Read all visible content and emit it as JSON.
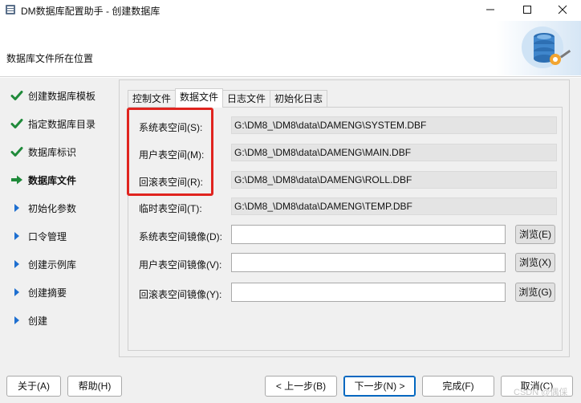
{
  "window": {
    "title": "DM数据库配置助手 - 创建数据库",
    "minimize_icon": "minimize-icon",
    "maximize_icon": "maximize-icon",
    "close_icon": "close-icon"
  },
  "banner": {
    "title": "数据库文件所在位置",
    "art_icon": "database-gear-icon"
  },
  "steps": [
    {
      "label": "创建数据库模板",
      "state": "done"
    },
    {
      "label": "指定数据库目录",
      "state": "done"
    },
    {
      "label": "数据库标识",
      "state": "done"
    },
    {
      "label": "数据库文件",
      "state": "current"
    },
    {
      "label": "初始化参数",
      "state": "pending"
    },
    {
      "label": "口令管理",
      "state": "pending"
    },
    {
      "label": "创建示例库",
      "state": "pending"
    },
    {
      "label": "创建摘要",
      "state": "pending"
    },
    {
      "label": "创建",
      "state": "pending"
    }
  ],
  "tabs": [
    {
      "label": "控制文件",
      "active": false
    },
    {
      "label": "数据文件",
      "active": true
    },
    {
      "label": "日志文件",
      "active": false
    },
    {
      "label": "初始化日志",
      "active": false
    }
  ],
  "datafiles": {
    "rows": [
      {
        "label": "系统表空间(S):",
        "value": "G:\\DM8_\\DM8\\data\\DAMENG\\SYSTEM.DBF"
      },
      {
        "label": "用户表空间(M):",
        "value": "G:\\DM8_\\DM8\\data\\DAMENG\\MAIN.DBF"
      },
      {
        "label": "回滚表空间(R):",
        "value": "G:\\DM8_\\DM8\\data\\DAMENG\\ROLL.DBF"
      },
      {
        "label": "临时表空间(T):",
        "value": "G:\\DM8_\\DM8\\data\\DAMENG\\TEMP.DBF"
      }
    ],
    "mirrors": [
      {
        "label": "系统表空间镜像(D):",
        "value": "",
        "button": "浏览(E)"
      },
      {
        "label": "用户表空间镜像(V):",
        "value": "",
        "button": "浏览(X)"
      },
      {
        "label": "回滚表空间镜像(Y):",
        "value": "",
        "button": "浏览(G)"
      }
    ]
  },
  "footer": {
    "about": "关于(A)",
    "help": "帮助(H)",
    "prev": "< 上一步(B)",
    "next": "下一步(N) >",
    "finish": "完成(F)",
    "cancel": "取消(C)"
  },
  "watermark": "CSDN @偶倸",
  "colors": {
    "check": "#1f8a3a",
    "arrow": "#1f8a3a",
    "pending_marker": "#1e6fd0",
    "highlight": "#e0241f",
    "default_button": "#0067c0"
  }
}
